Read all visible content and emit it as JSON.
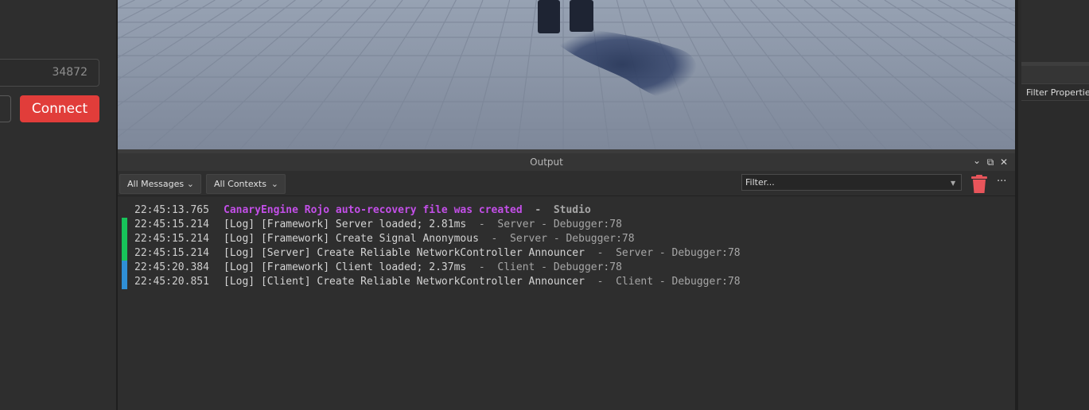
{
  "rojo": {
    "port_value": "34872",
    "connect_label": "Connect"
  },
  "right_panel": {
    "filter_label": "Filter Properties"
  },
  "output": {
    "title": "Output",
    "chevron_icon": "⌄",
    "float_icon": "⧉",
    "close_icon": "✕",
    "messages_filter": "All Messages",
    "contexts_filter": "All Contexts",
    "filter_placeholder": "Filter...",
    "more_icon": "···",
    "colors": {
      "system_message": "#c34fe8",
      "server_bar": "#17c45a",
      "client_bar": "#2f8fd6",
      "clear_icon": "#e8555b",
      "connect": "#e13d3a"
    },
    "entries": [
      {
        "time": "22:45:13.765",
        "message": "CanaryEngine Rojo auto-recovery file was created",
        "source": "  -  Studio",
        "bar": "none"
      },
      {
        "time": "22:45:15.214",
        "message": "[Log] [Framework] Server loaded; 2.81ms",
        "source": "  -  Server - Debugger:78",
        "bar": "server"
      },
      {
        "time": "22:45:15.214",
        "message": "[Log] [Framework] Create Signal Anonymous",
        "source": "  -  Server - Debugger:78",
        "bar": "server"
      },
      {
        "time": "22:45:15.214",
        "message": "[Log] [Server] Create Reliable NetworkController Announcer",
        "source": "  -  Server - Debugger:78",
        "bar": "server"
      },
      {
        "time": "22:45:20.384",
        "message": "[Log] [Framework] Client loaded; 2.37ms",
        "source": "  -  Client - Debugger:78",
        "bar": "client"
      },
      {
        "time": "22:45:20.851",
        "message": "[Log] [Client] Create Reliable NetworkController Announcer",
        "source": "  -  Client - Debugger:78",
        "bar": "client"
      }
    ]
  }
}
